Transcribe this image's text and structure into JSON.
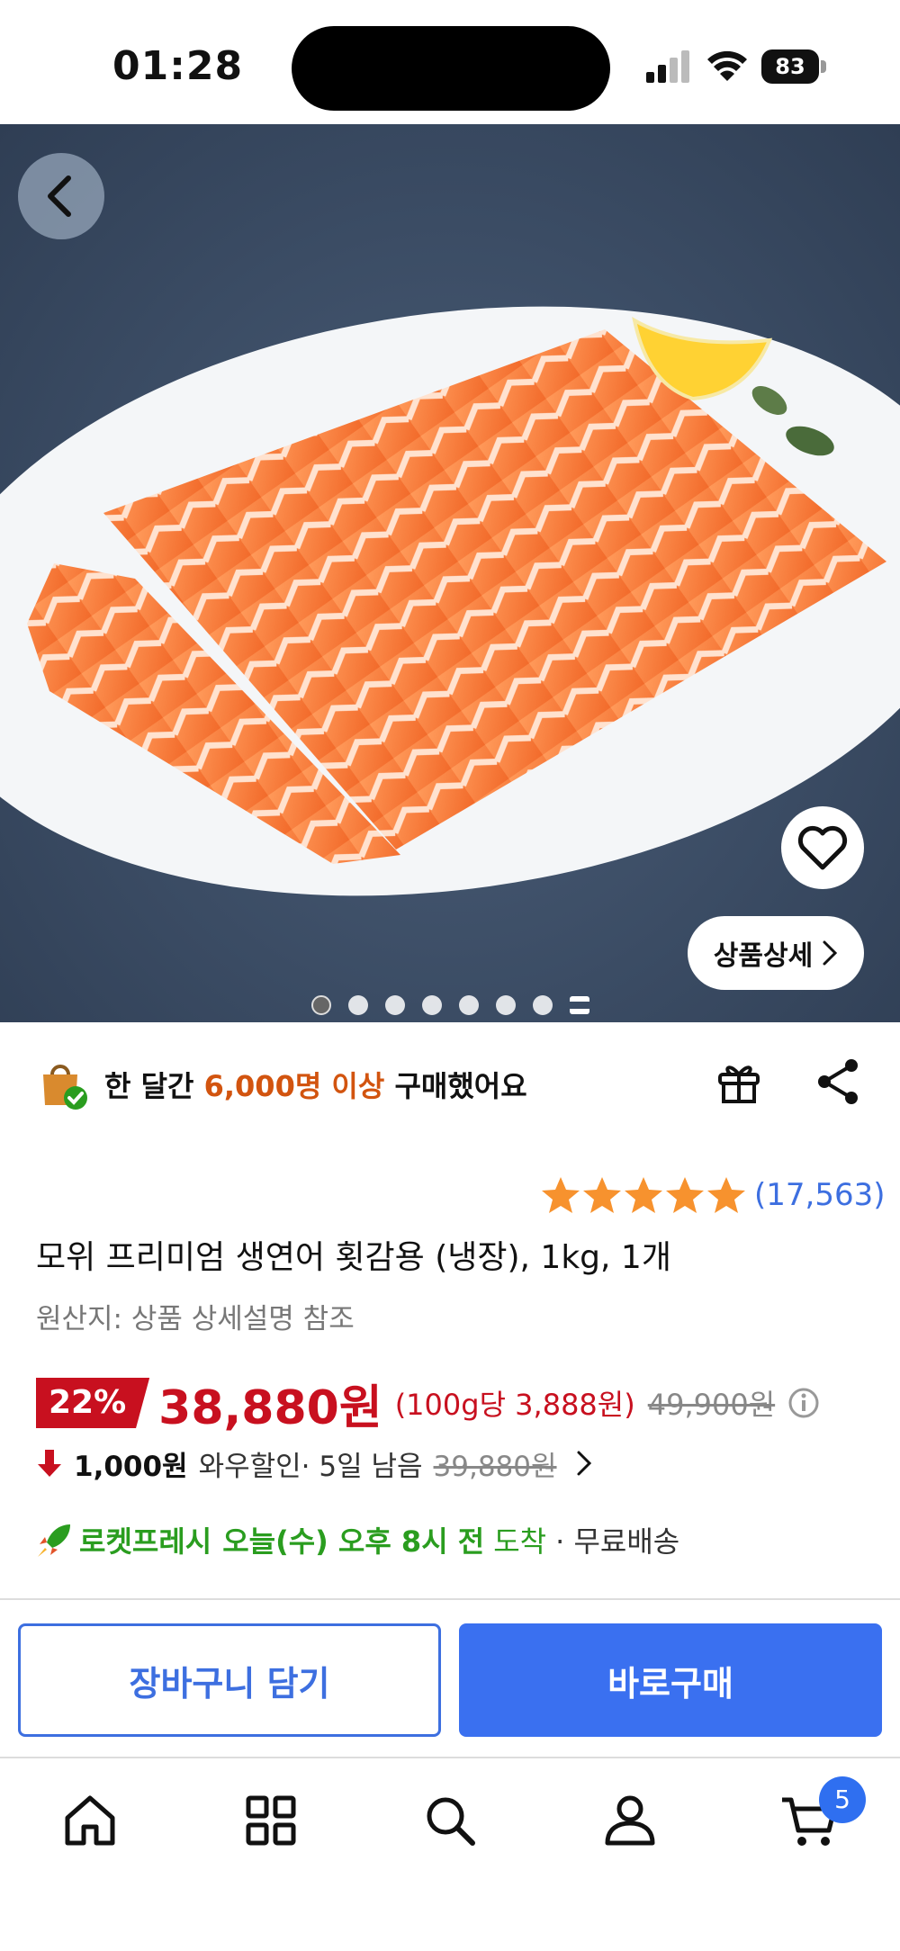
{
  "status_bar": {
    "time": "01:28",
    "battery": "83"
  },
  "hero": {
    "detail_label": "상품상세",
    "dots_count": 8,
    "active_dot": 0
  },
  "info": {
    "buy_prefix": "한 달간 ",
    "buy_highlight": "6,000명 이상",
    "buy_suffix": " 구매했어요",
    "rating_stars": 5,
    "rating_count": "(17,563)",
    "title": "모위 프리미엄 생연어 횟감용 (냉장), 1kg, 1개",
    "origin": "원산지: 상품 상세설명 참조"
  },
  "price": {
    "discount": "22%",
    "current": "38,880원",
    "unit": "(100g당 3,888원)",
    "original": "49,900원"
  },
  "wow": {
    "amount": "1,000원",
    "label": "와우할인",
    "sep": " · 5일 남음 ",
    "original": "39,880원"
  },
  "delivery": {
    "label": "로켓프레시",
    "time": "오늘(수) 오후 8시 전",
    "arrive": "도착",
    "free": "· 무료배송"
  },
  "buttons": {
    "cart": "장바구니 담기",
    "buy": "바로구매"
  },
  "tab_bar": {
    "items": [
      "home-icon",
      "category-icon",
      "search-icon",
      "profile-icon",
      "cart-icon"
    ],
    "cart_badge": "5"
  },
  "colors": {
    "accent_blue": "#3a70f0",
    "price_red": "#c8101f",
    "rocket_green": "#2a9d1f",
    "highlight_orange": "#d2540f"
  }
}
